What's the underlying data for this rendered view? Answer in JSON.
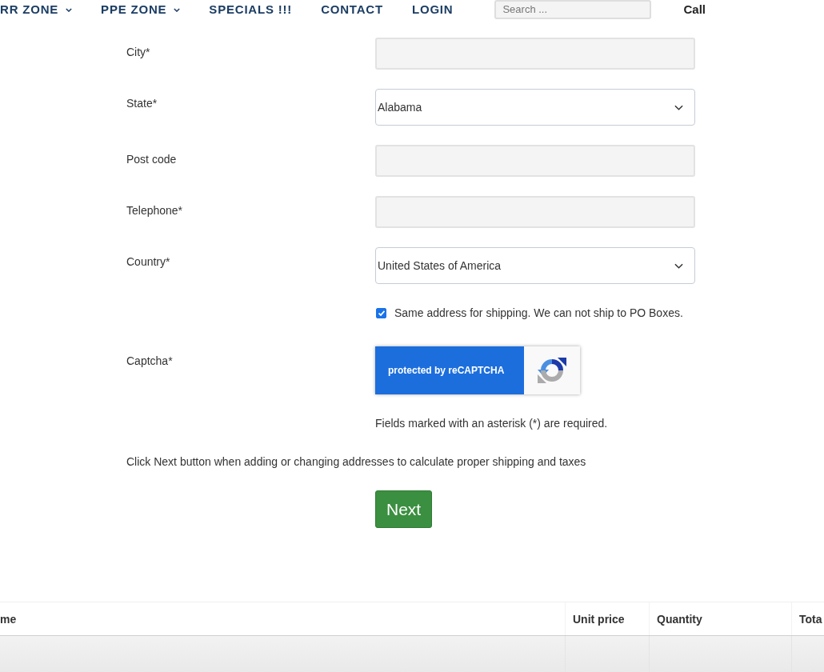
{
  "header": {
    "nav": [
      {
        "label": "RR ZONE",
        "has_menu": true
      },
      {
        "label": "PPE ZONE",
        "has_menu": true
      },
      {
        "label": "SPECIALS !!!",
        "has_menu": false
      },
      {
        "label": "CONTACT",
        "has_menu": false
      },
      {
        "label": "LOGIN",
        "has_menu": false
      }
    ],
    "search": {
      "placeholder": "Search ..."
    },
    "call_label": "Call"
  },
  "form": {
    "fields": [
      {
        "kind": "input",
        "label": "City*"
      },
      {
        "kind": "select",
        "label": "State*",
        "value": "Alabama"
      },
      {
        "kind": "input",
        "label": "Post code"
      },
      {
        "kind": "input",
        "label": "Telephone*"
      },
      {
        "kind": "select",
        "label": "Country*",
        "value": "United States of America"
      }
    ],
    "same_address": {
      "label": "Same address for shipping. We can not ship to PO Boxes.",
      "checked": true
    },
    "captcha": {
      "label": "Captcha*",
      "badge_text": "protected by reCAPTCHA"
    },
    "required_note": "Fields marked with an asterisk (*) are required.",
    "next_hint": "Click Next button when adding or changing addresses to calculate proper shipping and taxes",
    "next_button": "Next"
  },
  "table": {
    "columns": [
      "me",
      "Unit price",
      "Quantity",
      "Tota"
    ]
  }
}
